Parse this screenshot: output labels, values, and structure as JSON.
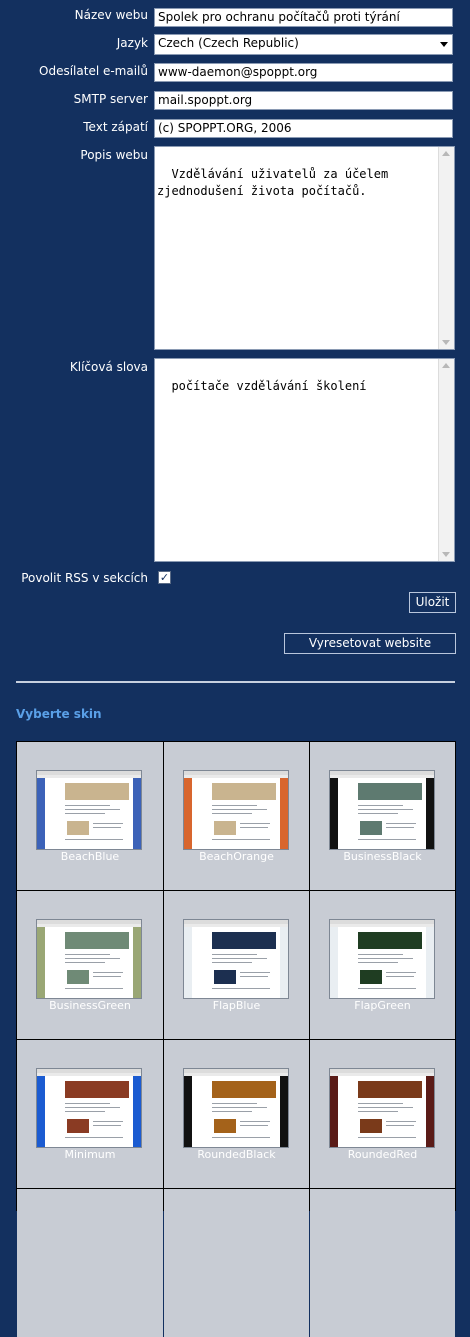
{
  "form": {
    "site_name": {
      "label": "Název webu",
      "value": "Spolek pro ochranu počítačů proti týrání"
    },
    "language": {
      "label": "Jazyk",
      "value": "Czech (Czech Republic)"
    },
    "sender_email": {
      "label": "Odesílatel e-mailů",
      "value": "www-daemon@spoppt.org"
    },
    "smtp_server": {
      "label": "SMTP server",
      "value": "mail.spoppt.org"
    },
    "footer_text": {
      "label": "Text zápatí",
      "value": "(c) SPOPPT.ORG, 2006"
    },
    "site_description": {
      "label": "Popis webu",
      "value": "Vzdělávání uživatelů za účelem\nzjednodušení života počítačů."
    },
    "keywords": {
      "label": "Klíčová slova",
      "value": "počítače vzdělávání školení"
    },
    "rss": {
      "label": "Povolit RSS v sekcích",
      "checked": true,
      "check_glyph": "✓"
    }
  },
  "buttons": {
    "save": "Uložit",
    "reset": "Vyresetovat website"
  },
  "skins": {
    "title": "Vyberte skin",
    "items": [
      {
        "name": "BeachBlue",
        "side": "#3c62b8",
        "banner": "#c9b48f",
        "body": "#ffffff"
      },
      {
        "name": "BeachOrange",
        "side": "#d8662e",
        "banner": "#c9b48f",
        "body": "#ffffff"
      },
      {
        "name": "BusinessBlack",
        "side": "#111111",
        "banner": "#5e7a70",
        "body": "#ffffff"
      },
      {
        "name": "BusinessGreen",
        "side": "#9aa775",
        "banner": "#6f8a76",
        "body": "#ffffff"
      },
      {
        "name": "FlapBlue",
        "side": "#e9eef2",
        "banner": "#1c2f50",
        "body": "#ffffff"
      },
      {
        "name": "FlapGreen",
        "side": "#e9eef2",
        "banner": "#1f3d22",
        "body": "#ffffff"
      },
      {
        "name": "Minimum",
        "side": "#1b5bd1",
        "banner": "#8a3b23",
        "body": "#ffffff"
      },
      {
        "name": "RoundedBlack",
        "side": "#111111",
        "banner": "#a4621a",
        "body": "#ffffff"
      },
      {
        "name": "RoundedRed",
        "side": "#5a1b17",
        "banner": "#7a3a1a",
        "body": "#ffffff"
      }
    ]
  }
}
